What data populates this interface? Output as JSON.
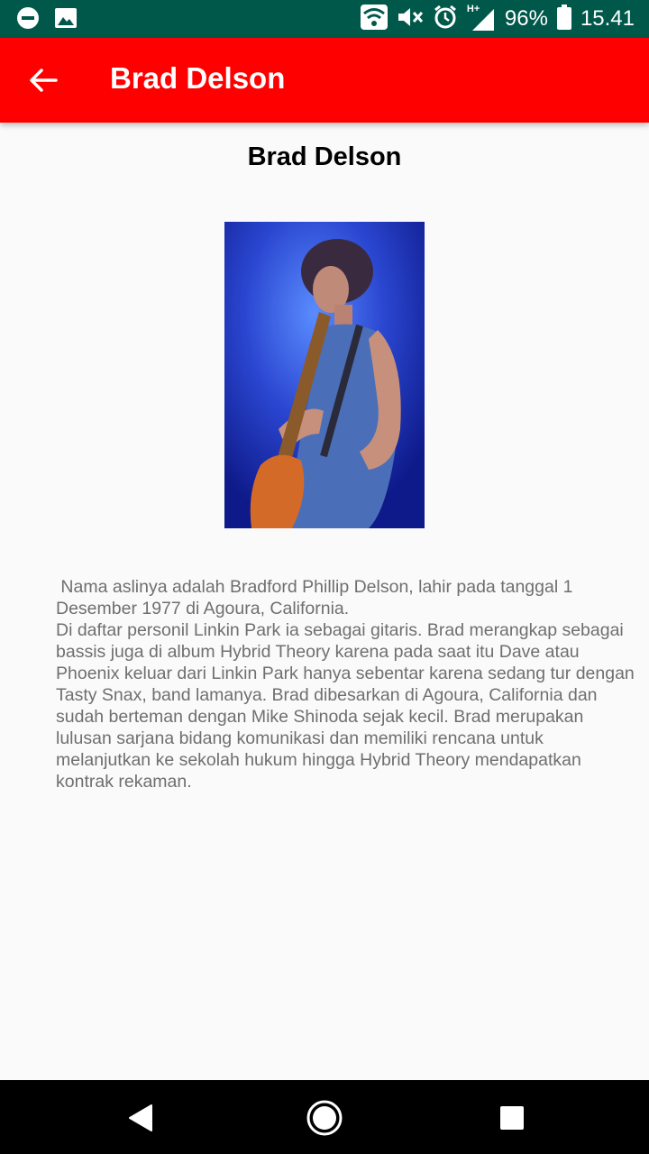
{
  "status_bar": {
    "battery_percent": "96%",
    "time": "15.41",
    "network_type": "H+",
    "icons": [
      "do-not-disturb-icon",
      "image-icon",
      "wifi-icon",
      "mute-icon",
      "alarm-icon",
      "signal-icon",
      "battery-icon"
    ]
  },
  "toolbar": {
    "title": "Brad Delson",
    "background_color": "#ff0000",
    "back_icon": "arrow-left-icon"
  },
  "detail": {
    "heading": "Brad Delson",
    "photo": "guitarist-photo",
    "bio": " Nama aslinya adalah Bradford Phillip Delson, lahir pada tanggal 1 Desember 1977 di Agoura, California.\nDi daftar personil Linkin Park ia sebagai gitaris. Brad merangkap sebagai bassis juga di album Hybrid Theory karena pada saat itu Dave atau Phoenix keluar dari Linkin Park hanya sebentar karena sedang tur dengan Tasty Snax, band lamanya. Brad dibesarkan di Agoura, California dan sudah berteman dengan Mike Shinoda sejak kecil. Brad merupakan lulusan sarjana bidang komunikasi dan memiliki rencana untuk melanjutkan ke sekolah hukum hingga Hybrid Theory mendapatkan kontrak rekaman."
  },
  "nav_bar": {
    "buttons": [
      "back-triangle-icon",
      "home-circle-icon",
      "recents-square-icon"
    ]
  }
}
